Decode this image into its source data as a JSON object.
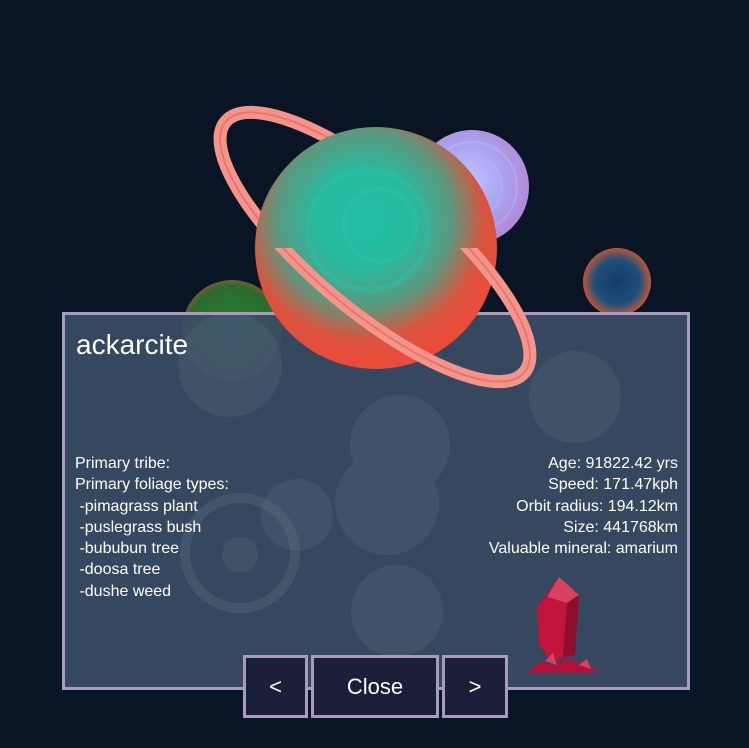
{
  "planet": {
    "name": "ackarcite",
    "tribe_label": "Primary tribe:",
    "foliage_label": "Primary foliage types:",
    "foliage": [
      " -pimagrass plant",
      " -puslegrass bush",
      " -bububun tree",
      " -doosa tree",
      " -dushe weed"
    ],
    "age": "Age: 91822.42 yrs",
    "speed": "Speed: 171.47kph",
    "orbit_radius": "Orbit radius: 194.12km",
    "size": "Size: 441768km",
    "mineral": "Valuable mineral: amarium"
  },
  "controls": {
    "prev_label": "<",
    "close_label": "Close",
    "next_label": ">"
  },
  "colors": {
    "background": "#091524",
    "panel": "#3a4d65",
    "panel_border": "#a89bbd",
    "button_bg": "#1a1f3a",
    "planet_core": "#1fb89f",
    "planet_edge": "#e94b3c",
    "ring": "#f4948a",
    "moon": "#a8a4f0",
    "small_planet": "#1d4f7a",
    "crystal": "#c0143a"
  },
  "icons": {
    "mineral": "red-crystal-icon"
  }
}
